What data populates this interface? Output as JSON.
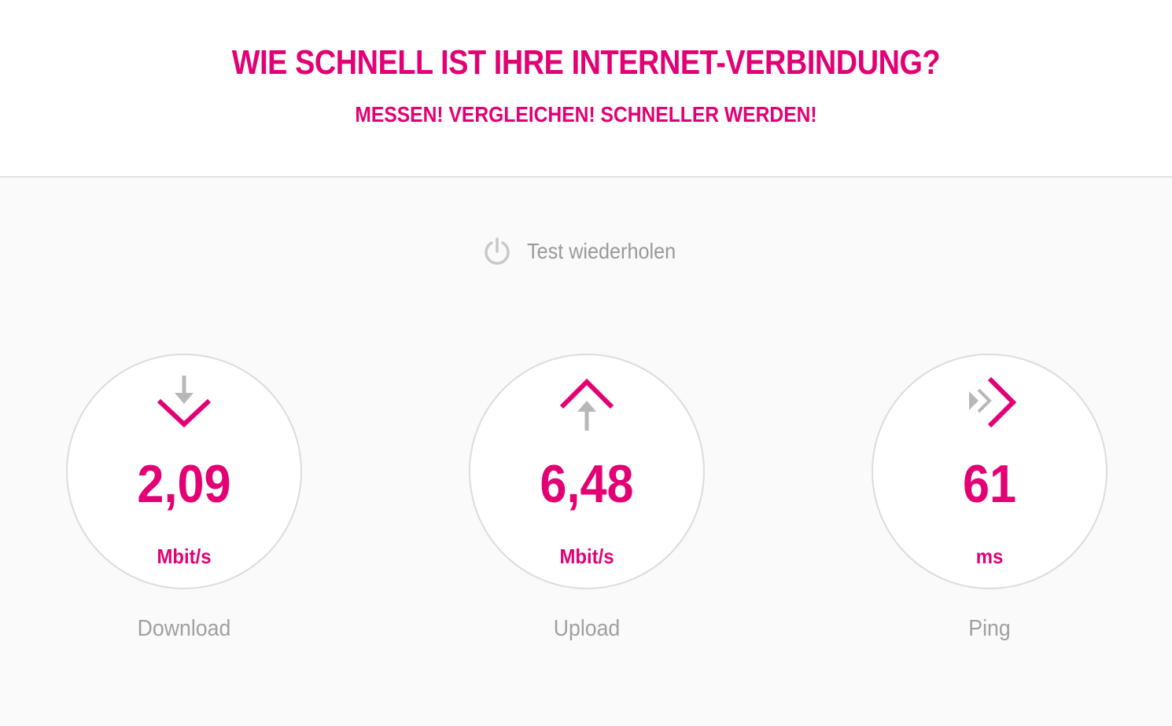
{
  "header": {
    "title": "WIE SCHNELL IST IHRE INTERNET-VERBINDUNG?",
    "subtitle": "MESSEN! VERGLEICHEN! SCHNELLER WERDEN!"
  },
  "retest": {
    "label": "Test wiederholen",
    "icon": "power-icon"
  },
  "colors": {
    "accent": "#e20074",
    "muted": "#a0a0a0",
    "icon_grey": "#b8b8b8"
  },
  "metrics": [
    {
      "id": "download",
      "icon": "download-arrow-icon",
      "value": "2,09",
      "unit": "Mbit/s",
      "label": "Download"
    },
    {
      "id": "upload",
      "icon": "upload-arrow-icon",
      "value": "6,48",
      "unit": "Mbit/s",
      "label": "Upload"
    },
    {
      "id": "ping",
      "icon": "ping-chevrons-icon",
      "value": "61",
      "unit": "ms",
      "label": "Ping"
    }
  ]
}
